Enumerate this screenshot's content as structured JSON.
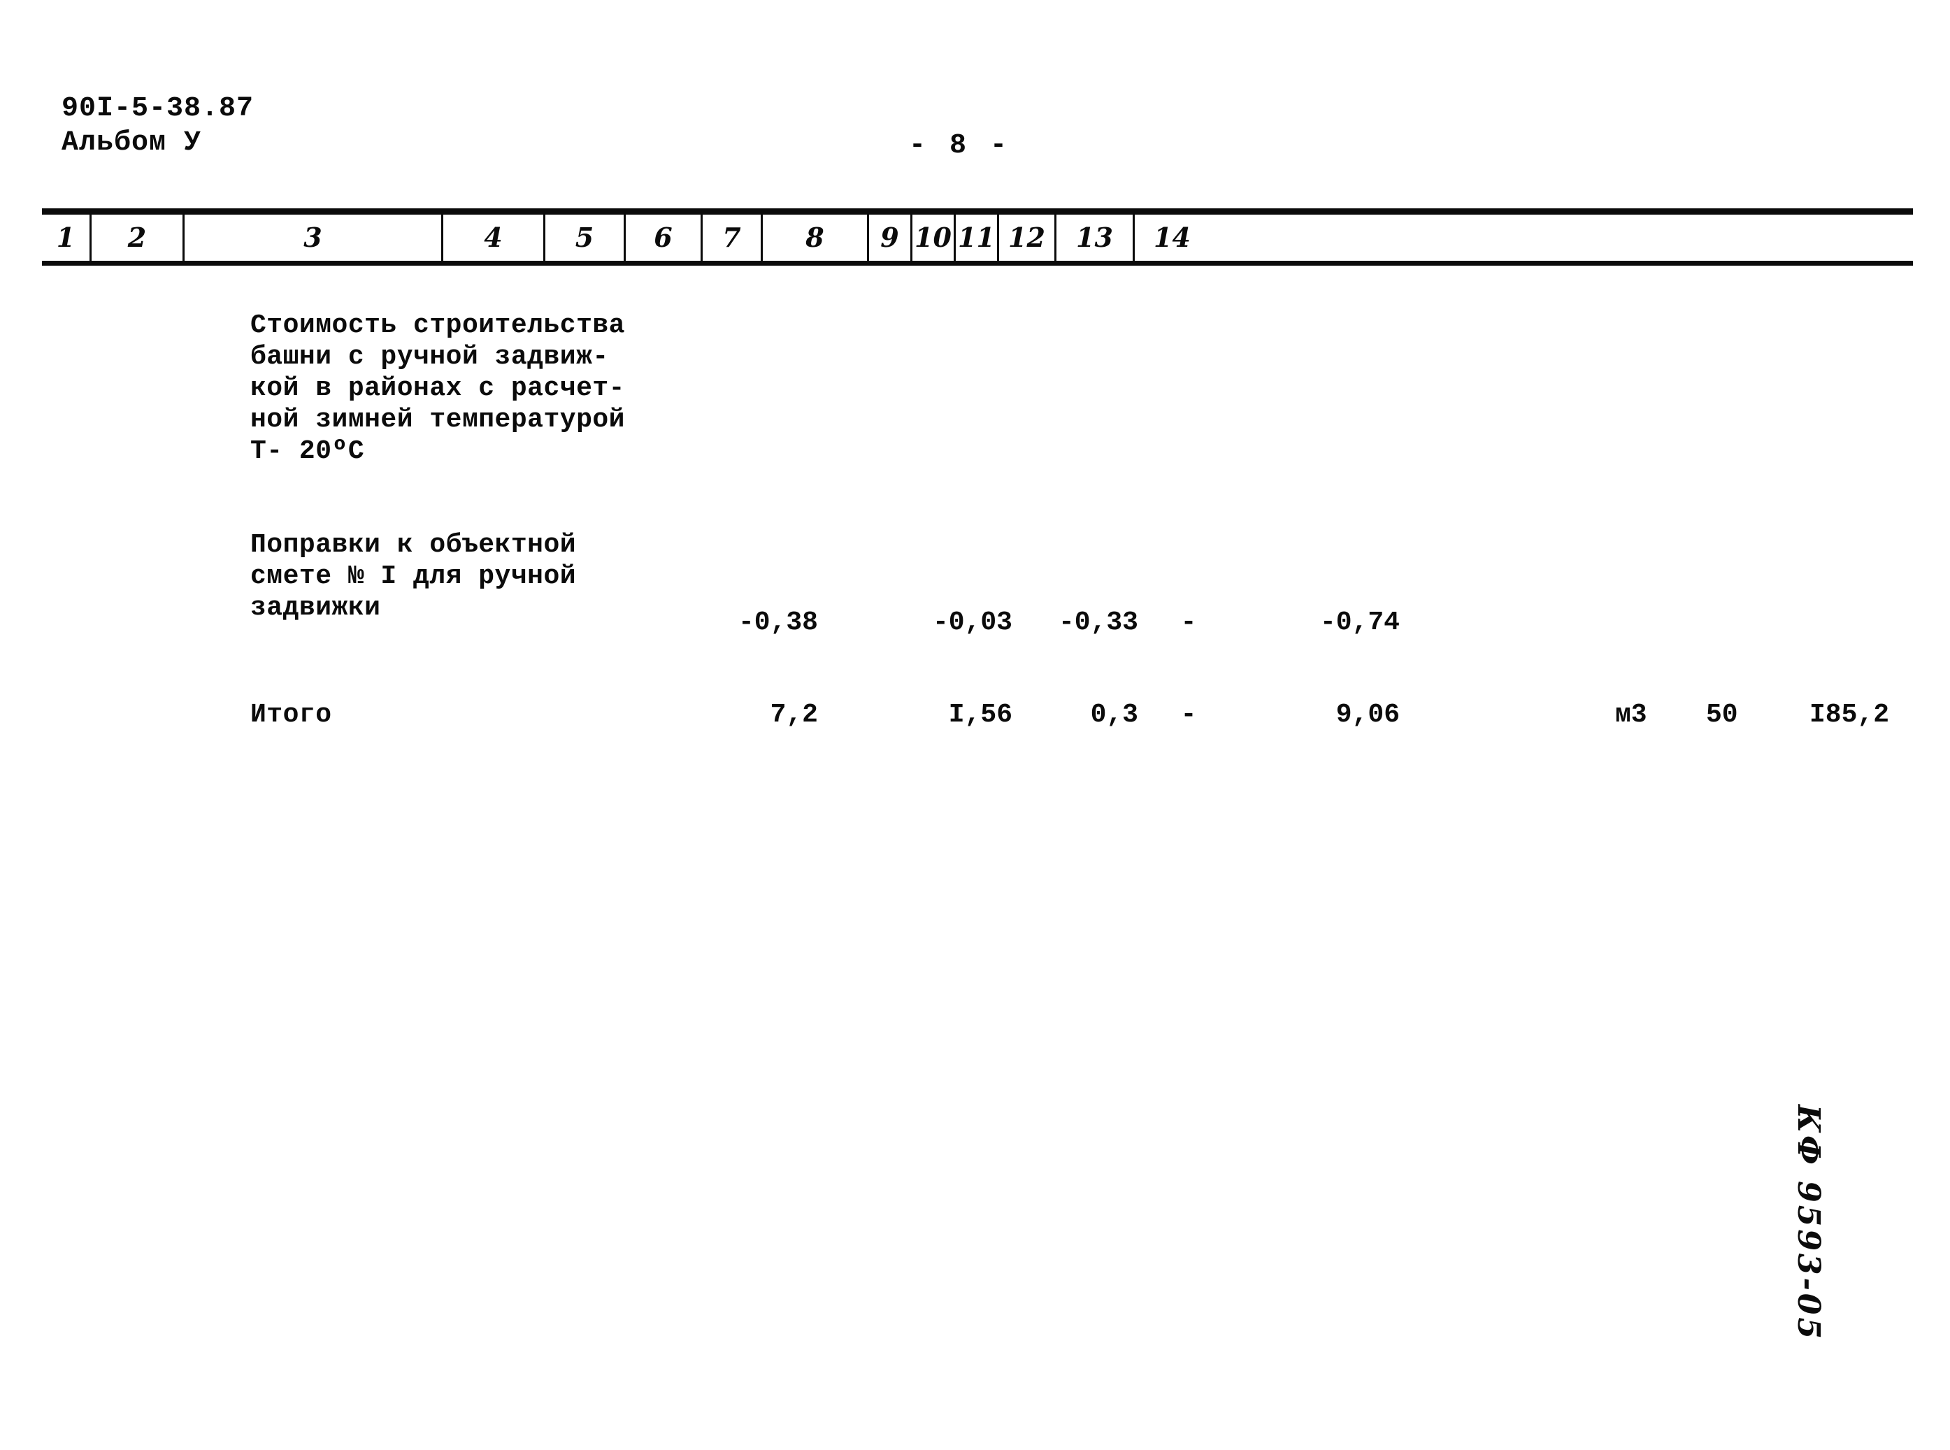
{
  "header": {
    "doc_code": "90I-5-38.87",
    "album": "Альбом У",
    "page_marker": "- 8 -"
  },
  "table": {
    "column_numbers": [
      "1",
      "2",
      "3",
      "4",
      "5",
      "6",
      "7",
      "8",
      "9",
      "10",
      "11",
      "12",
      "13",
      "14"
    ],
    "rows": [
      {
        "name": "cost-of-construction",
        "description": "Стоимость строительства\nбашни с ручной задвиж-\nкой в районах с расчет-\nной зимней температурой\nТ- 20ºС",
        "col4": "",
        "col5": "",
        "col6": "",
        "col7": "",
        "col8": "",
        "col11": "",
        "col12": "",
        "col13": ""
      },
      {
        "name": "corrections-to-estimate",
        "description": "Поправки к объектной\nсмете № I для ручной\nзадвижки",
        "col4": "-0,38",
        "col5": "-0,03",
        "col6": "-0,33",
        "col7": "-",
        "col8": "-0,74",
        "col11": "",
        "col12": "",
        "col13": ""
      },
      {
        "name": "total",
        "description": "Итого",
        "col4": "7,2",
        "col5": "I,56",
        "col6": "0,3",
        "col7": "-",
        "col8": "9,06",
        "col11": "м3",
        "col12": "50",
        "col13": "I85,2"
      }
    ]
  },
  "margin_note": "КФ 9593-05"
}
